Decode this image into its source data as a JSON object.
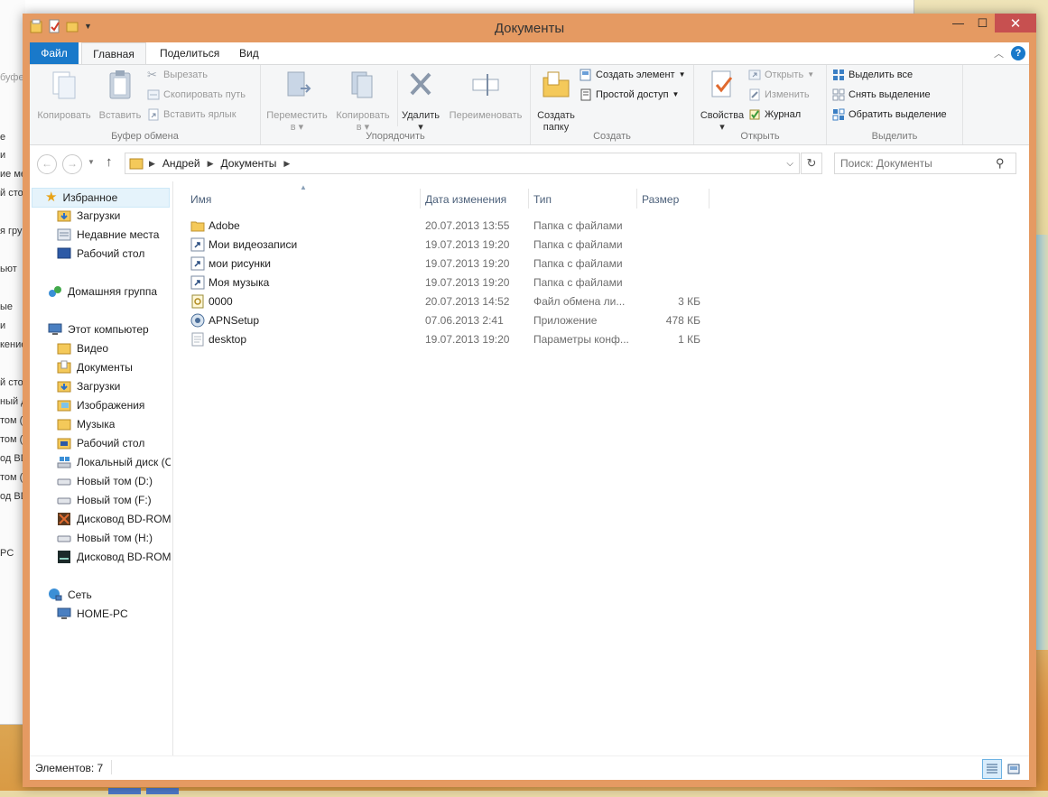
{
  "background_window": {
    "fragments": [
      "е",
      "и",
      "ие ме",
      "й сто",
      "я гру",
      "ьют",
      "ые",
      "и",
      "кение",
      "й сто",
      "ный д",
      "том (",
      "том (",
      "од BD",
      "том (",
      "од BD",
      "PC"
    ],
    "toolbar_fragments": [
      "буфер"
    ]
  },
  "window": {
    "title": "Документы",
    "close_glyph": "✕",
    "maximize_glyph": "☐",
    "minimize_glyph": "—"
  },
  "tabs": {
    "file": "Файл",
    "home": "Главная",
    "share": "Поделиться",
    "view": "Вид",
    "help": "?"
  },
  "ribbon": {
    "clipboard": {
      "label": "Буфер обмена",
      "copy": "Копировать",
      "paste": "Вставить",
      "cut": "Вырезать",
      "copy_path": "Скопировать путь",
      "paste_shortcut": "Вставить ярлык"
    },
    "organize": {
      "label": "Упорядочить",
      "move_to": "Переместить",
      "copy_to": "Копировать",
      "to": "в",
      "delete": "Удалить",
      "rename": "Переименовать"
    },
    "create": {
      "label": "Создать",
      "new_folder_1": "Создать",
      "new_folder_2": "папку",
      "new_item": "Создать элемент",
      "easy_access": "Простой доступ"
    },
    "open": {
      "label": "Открыть",
      "properties": "Свойства",
      "open": "Открыть",
      "edit": "Изменить",
      "history": "Журнал"
    },
    "select": {
      "label": "Выделить",
      "select_all": "Выделить все",
      "select_none": "Снять выделение",
      "invert": "Обратить выделение"
    }
  },
  "address": {
    "segments": [
      "Андрей",
      "Документы"
    ],
    "search_placeholder": "Поиск: Документы"
  },
  "nav": {
    "favorites": "Избранное",
    "downloads": "Загрузки",
    "recent": "Недавние места",
    "desktop": "Рабочий стол",
    "homegroup": "Домашняя группа",
    "this_pc": "Этот компьютер",
    "pc_items": [
      "Видео",
      "Документы",
      "Загрузки",
      "Изображения",
      "Музыка",
      "Рабочий стол",
      "Локальный диск (С",
      "Новый том (D:)",
      "Новый том (F:)",
      "Дисковод BD-ROM",
      "Новый том (H:)",
      "Дисковод BD-ROM"
    ],
    "network": "Сеть",
    "home_pc": "HOME-PC"
  },
  "columns": {
    "name": "Имя",
    "date": "Дата изменения",
    "type": "Тип",
    "size": "Размер"
  },
  "files": [
    {
      "name": "Adobe",
      "date": "20.07.2013 13:55",
      "type": "Папка с файлами",
      "size": "",
      "icon": "folder-icon"
    },
    {
      "name": "Мои видеозаписи",
      "date": "19.07.2013 19:20",
      "type": "Папка с файлами",
      "size": "",
      "icon": "shortcut-icon"
    },
    {
      "name": "мои рисунки",
      "date": "19.07.2013 19:20",
      "type": "Папка с файлами",
      "size": "",
      "icon": "shortcut-icon"
    },
    {
      "name": "Моя музыка",
      "date": "19.07.2013 19:20",
      "type": "Папка с файлами",
      "size": "",
      "icon": "shortcut-icon"
    },
    {
      "name": "0000",
      "date": "20.07.2013 14:52",
      "type": "Файл обмена ли...",
      "size": "3 КБ",
      "icon": "swap-file-icon"
    },
    {
      "name": "APNSetup",
      "date": "07.06.2013 2:41",
      "type": "Приложение",
      "size": "478 КБ",
      "icon": "application-icon"
    },
    {
      "name": "desktop",
      "date": "19.07.2013 19:20",
      "type": "Параметры конф...",
      "size": "1 КБ",
      "icon": "config-file-icon"
    }
  ],
  "status": {
    "items_count": "Элементов: 7"
  }
}
